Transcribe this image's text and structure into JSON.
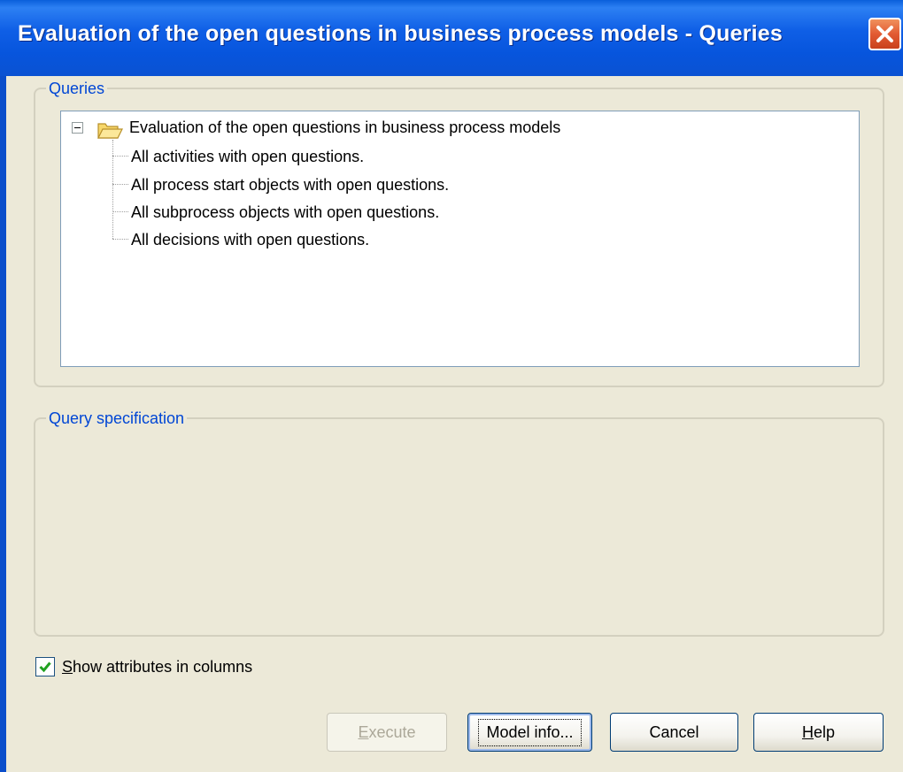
{
  "window": {
    "title": "Evaluation of the open questions in business process models - Queries",
    "close_icon": "close-icon"
  },
  "queries_group": {
    "legend": "Queries",
    "tree": {
      "root": {
        "label": "Evaluation of the open questions in business process models",
        "icon": "folder-open-icon",
        "expanded": true
      },
      "items": [
        "All activities with open questions.",
        "All process start objects with open questions.",
        "All subprocess objects with open questions.",
        "All decisions with open questions."
      ]
    }
  },
  "spec_group": {
    "legend": "Query specification"
  },
  "options": {
    "show_attributes": {
      "label_accel": "S",
      "label_rest": "how attributes in columns",
      "checked": true
    }
  },
  "buttons": {
    "execute": {
      "accel": "E",
      "rest": "xecute",
      "enabled": false
    },
    "model_info": {
      "label": "Model info...",
      "accel_index": 8
    },
    "cancel": {
      "label": "Cancel"
    },
    "help": {
      "accel": "H",
      "rest": "elp"
    }
  },
  "colors": {
    "titlebar": "#0A5FDB",
    "dialog_bg": "#ECE9D8",
    "group_legend": "#0046D5",
    "close_button": "#E25A32"
  }
}
